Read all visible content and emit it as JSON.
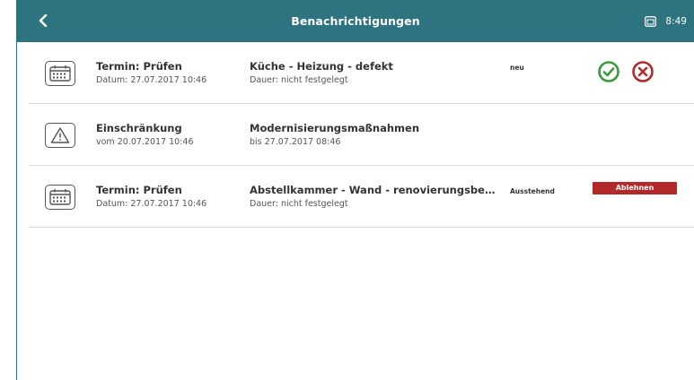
{
  "header": {
    "title": "Benachrichtigungen",
    "time": "8:49"
  },
  "colors": {
    "header_bg": "#2d7380",
    "accept": "#3a9a3e",
    "reject": "#b32828"
  },
  "notifications": [
    {
      "icon": "calendar-icon",
      "title": "Termin: Prüfen",
      "subtitle": "Datum: 27.07.2017 10:46",
      "detail_title": "Küche - Heizung - defekt",
      "detail_subtitle": "Dauer: nicht festgelegt",
      "status": "neu"
    },
    {
      "icon": "warning-icon",
      "title": "Einschränkung",
      "subtitle": "vom 20.07.2017 10:46",
      "detail_title": "Modernisierungsmaßnahmen",
      "detail_subtitle": "bis 27.07.2017 08:46"
    },
    {
      "icon": "calendar-icon",
      "title": "Termin: Prüfen",
      "subtitle": "Datum: 27.07.2017 10:46",
      "detail_title": "Abstellkammer - Wand - renovierungsbedü…",
      "detail_subtitle": "Dauer: nicht festgelegt",
      "status": "Ausstehend",
      "action_label": "Ablehnen"
    }
  ]
}
